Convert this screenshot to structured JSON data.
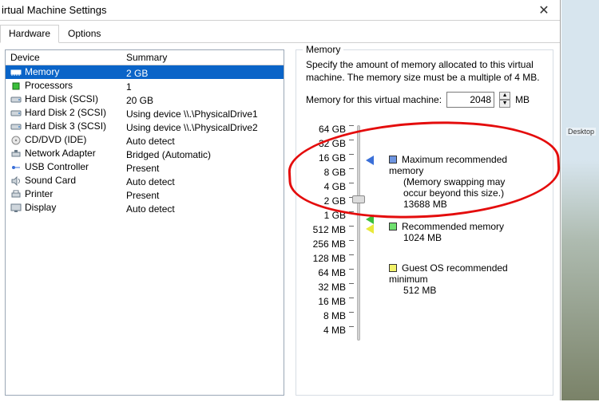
{
  "window": {
    "title": "irtual Machine Settings",
    "close": "✕"
  },
  "tabs": {
    "hardware": "Hardware",
    "options": "Options"
  },
  "device_list": {
    "headers": {
      "device": "Device",
      "summary": "Summary"
    },
    "rows": [
      {
        "icon": "memory",
        "device": "Memory",
        "summary": "2 GB",
        "selected": true
      },
      {
        "icon": "cpu",
        "device": "Processors",
        "summary": "1"
      },
      {
        "icon": "disk",
        "device": "Hard Disk (SCSI)",
        "summary": "20 GB"
      },
      {
        "icon": "disk",
        "device": "Hard Disk 2 (SCSI)",
        "summary": "Using device \\\\.\\PhysicalDrive1"
      },
      {
        "icon": "disk",
        "device": "Hard Disk 3 (SCSI)",
        "summary": "Using device \\\\.\\PhysicalDrive2"
      },
      {
        "icon": "cd",
        "device": "CD/DVD (IDE)",
        "summary": "Auto detect"
      },
      {
        "icon": "net",
        "device": "Network Adapter",
        "summary": "Bridged (Automatic)"
      },
      {
        "icon": "usb",
        "device": "USB Controller",
        "summary": "Present"
      },
      {
        "icon": "sound",
        "device": "Sound Card",
        "summary": "Auto detect"
      },
      {
        "icon": "printer",
        "device": "Printer",
        "summary": "Present"
      },
      {
        "icon": "display",
        "device": "Display",
        "summary": "Auto detect"
      }
    ]
  },
  "memory": {
    "group_label": "Memory",
    "description": "Specify the amount of memory allocated to this virtual machine. The memory size must be a multiple of 4 MB.",
    "field_label": "Memory for this virtual machine:",
    "field_value": "2048",
    "field_unit": "MB",
    "slider_labels": [
      "64 GB",
      "32 GB",
      "16 GB",
      "8 GB",
      "4 GB",
      "2 GB",
      "1 GB",
      "512 MB",
      "256 MB",
      "128 MB",
      "64 MB",
      "32 MB",
      "16 MB",
      "8 MB",
      "4 MB"
    ],
    "legend": {
      "max": {
        "title": "Maximum recommended memory",
        "sub1": "(Memory swapping may",
        "sub2": "occur beyond this size.)",
        "value": "13688 MB"
      },
      "rec": {
        "title": "Recommended memory",
        "value": "1024 MB"
      },
      "guest": {
        "title": "Guest OS recommended minimum",
        "value": "512 MB"
      }
    }
  },
  "desktop_label": "Desktop"
}
